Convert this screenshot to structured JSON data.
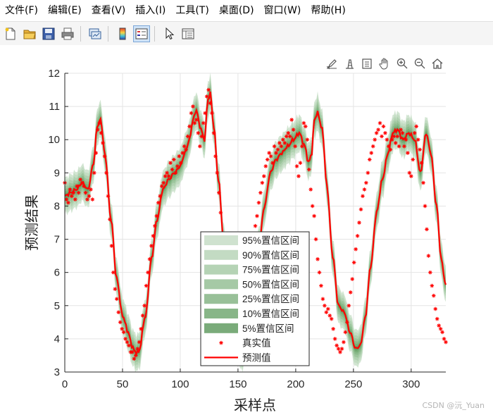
{
  "menu": [
    {
      "label": "文件(F)"
    },
    {
      "label": "编辑(E)"
    },
    {
      "label": "查看(V)"
    },
    {
      "label": "插入(I)"
    },
    {
      "label": "工具(T)"
    },
    {
      "label": "桌面(D)"
    },
    {
      "label": "窗口(W)"
    },
    {
      "label": "帮助(H)"
    }
  ],
  "toolbar_icons": [
    "new-figure-icon",
    "open-folder-icon",
    "save-icon",
    "print-icon",
    "link-plot-icon",
    "colorbar-icon",
    "legend-icon",
    "pointer-icon",
    "property-inspector-icon"
  ],
  "axes_toolbar_icons": [
    "brush-icon",
    "data-tips-icon",
    "rotate-icon",
    "pan-icon",
    "zoom-in-icon",
    "zoom-out-icon",
    "home-icon"
  ],
  "watermark": "CSDN @沅_Yuan",
  "colors": {
    "prediction": "#ff0000",
    "actual": "#ff0000",
    "bands": [
      "#d2e5d2",
      "#c2dcc2",
      "#b0d1b0",
      "#9cc59c",
      "#8aba8a",
      "#78ae78",
      "#669f66"
    ],
    "legend_bands": [
      "#cfe2cf",
      "#c3dbc3",
      "#b5d3b5",
      "#a5c9a5",
      "#98c098",
      "#88b688",
      "#7aab7a"
    ]
  },
  "chart_data": {
    "type": "line",
    "xlabel": "采样点",
    "ylabel": "预测结果",
    "xlim": [
      0,
      330
    ],
    "ylim": [
      3,
      12
    ],
    "xticks": [
      0,
      50,
      100,
      150,
      200,
      250,
      300
    ],
    "yticks": [
      3,
      4,
      5,
      6,
      7,
      8,
      9,
      10,
      11,
      12
    ],
    "grid": true,
    "legend_position": "bottom-center",
    "series": [
      {
        "name": "95%置信区间",
        "kind": "band",
        "halfwidth": 0.55
      },
      {
        "name": "90%置信区间",
        "kind": "band",
        "halfwidth": 0.46
      },
      {
        "name": "75%置信区间",
        "kind": "band",
        "halfwidth": 0.37
      },
      {
        "name": "50%置信区间",
        "kind": "band",
        "halfwidth": 0.28
      },
      {
        "name": "25%置信区间",
        "kind": "band",
        "halfwidth": 0.2
      },
      {
        "name": "10%置信区间",
        "kind": "band",
        "halfwidth": 0.13
      },
      {
        "name": "5%置信区间",
        "kind": "band",
        "halfwidth": 0.07
      },
      {
        "name": "真实值",
        "kind": "markers"
      },
      {
        "name": "预测值",
        "kind": "line"
      }
    ],
    "curve_keypoints": {
      "x": [
        0,
        5,
        10,
        15,
        20,
        25,
        28,
        31,
        35,
        40,
        45,
        50,
        55,
        58,
        61,
        64,
        70,
        75,
        80,
        85,
        90,
        95,
        100,
        104,
        108,
        111,
        114,
        117,
        121,
        124,
        126,
        129,
        133,
        138,
        143,
        148,
        153,
        158,
        163,
        168,
        173,
        178,
        183,
        188,
        193,
        198,
        203,
        208,
        211,
        214,
        216,
        219,
        223,
        227,
        232,
        237,
        242,
        247,
        252,
        256,
        260,
        265,
        270,
        275,
        280,
        284,
        288,
        293,
        298,
        303,
        308,
        313,
        317,
        322,
        326,
        330
      ],
      "y": [
        8.3,
        8.4,
        8.5,
        8.7,
        8.5,
        9.3,
        10.4,
        10.6,
        9.5,
        7.6,
        5.8,
        4.7,
        4.2,
        3.8,
        3.6,
        3.6,
        4.7,
        6.4,
        7.6,
        8.5,
        8.8,
        9.0,
        9.2,
        9.6,
        10.0,
        10.6,
        10.9,
        10.4,
        10.0,
        11.2,
        11.4,
        10.4,
        8.8,
        6.8,
        5.0,
        4.0,
        3.6,
        4.0,
        5.2,
        6.8,
        8.0,
        9.0,
        9.4,
        9.6,
        9.8,
        10.0,
        10.2,
        9.8,
        9.3,
        9.6,
        10.6,
        10.8,
        10.3,
        8.6,
        6.5,
        5.0,
        4.8,
        4.2,
        3.7,
        3.8,
        4.6,
        6.2,
        7.8,
        8.8,
        9.6,
        10.2,
        10.3,
        10.0,
        10.2,
        10.0,
        9.0,
        10.2,
        9.6,
        8.0,
        6.4,
        5.6
      ]
    },
    "actual_points": {
      "x": [
        0,
        1.5,
        3,
        4.5,
        6,
        7.5,
        9,
        10.5,
        12,
        13.5,
        15,
        16.5,
        18,
        19.5,
        21,
        22.5,
        24,
        25.5,
        27,
        28.5,
        30,
        31.5,
        33,
        34.5,
        36,
        37.5,
        39,
        40.5,
        42,
        43.5,
        45,
        46.5,
        48,
        49.5,
        51,
        52.5,
        54,
        55.5,
        57,
        58.5,
        60,
        61.5,
        63,
        64.5,
        66,
        67.5,
        69,
        70.5,
        72,
        73.5,
        75,
        76.5,
        78,
        79.5,
        81,
        82.5,
        84,
        85.5,
        87,
        88.5,
        90,
        91.5,
        93,
        94.5,
        96,
        97.5,
        99,
        100.5,
        102,
        103.5,
        105,
        106.5,
        108,
        109.5,
        111,
        112.5,
        114,
        115.5,
        117,
        118.5,
        120,
        121.5,
        123,
        124.5,
        126,
        127.5,
        129,
        130.5,
        132,
        133.5,
        135,
        136.5,
        138,
        139.5,
        141,
        142.5,
        144,
        145.5,
        147,
        148.5,
        150,
        151.5,
        153,
        154.5,
        156,
        157.5,
        159,
        160.5,
        162,
        163.5,
        165,
        166.5,
        168,
        169.5,
        171,
        172.5,
        174,
        175.5,
        177,
        178.5,
        180,
        181.5,
        183,
        184.5,
        186,
        187.5,
        189,
        190.5,
        192,
        193.5,
        195,
        196.5,
        198,
        199.5,
        201,
        202.5,
        204,
        205.5,
        207,
        208.5,
        210,
        211.5,
        213,
        214.5,
        216,
        217.5,
        219,
        220.5,
        222,
        223.5,
        225,
        226.5,
        228,
        229.5,
        231,
        232.5,
        234,
        235.5,
        237,
        238.5,
        240,
        241.5,
        243,
        244.5,
        246,
        247.5,
        249,
        250.5,
        252,
        253.5,
        255,
        256.5,
        258,
        259.5,
        261,
        262.5,
        264,
        265.5,
        267,
        268.5,
        270,
        271.5,
        273,
        274.5,
        276,
        277.5,
        279,
        280.5,
        282,
        283.5,
        285,
        286.5,
        288,
        289.5,
        291,
        292.5,
        294,
        295.5,
        297,
        298.5,
        300,
        301.5,
        303,
        304.5,
        306,
        307.5,
        309,
        310.5,
        312,
        313.5,
        315,
        316.5,
        318,
        319.5,
        321,
        322.5,
        324,
        325.5,
        327,
        328.5,
        330
      ],
      "y": [
        8.7,
        8.2,
        8.1,
        8.5,
        8.3,
        8.4,
        8.2,
        8.6,
        8.4,
        8.8,
        8.7,
        8.6,
        8.4,
        8.2,
        8.3,
        8.5,
        8.2,
        9.0,
        9.6,
        10.3,
        10.5,
        10.2,
        9.9,
        9.5,
        9.0,
        8.3,
        7.6,
        6.8,
        6.0,
        5.5,
        5.2,
        4.8,
        4.5,
        4.3,
        4.2,
        4.0,
        3.9,
        3.8,
        3.6,
        3.6,
        3.4,
        3.5,
        3.7,
        3.9,
        4.3,
        4.7,
        5.0,
        5.6,
        6.0,
        6.4,
        6.8,
        7.1,
        7.4,
        7.7,
        8.1,
        8.3,
        8.6,
        8.7,
        8.9,
        9.0,
        8.9,
        9.3,
        9.1,
        9.4,
        9.0,
        9.2,
        9.5,
        9.3,
        9.6,
        9.8,
        9.7,
        10.1,
        10.4,
        10.8,
        11.0,
        10.5,
        10.6,
        10.2,
        9.8,
        10.1,
        10.5,
        10.8,
        11.3,
        11.5,
        11.1,
        10.8,
        10.2,
        9.5,
        9.0,
        8.4,
        7.8,
        7.0,
        6.3,
        5.7,
        5.1,
        4.6,
        4.3,
        4.0,
        3.7,
        3.6,
        3.5,
        3.7,
        3.9,
        4.2,
        4.6,
        5.0,
        5.5,
        6.0,
        6.5,
        7.0,
        7.4,
        7.7,
        8.1,
        8.4,
        8.7,
        8.9,
        9.2,
        9.4,
        9.6,
        9.5,
        9.3,
        9.8,
        9.6,
        9.7,
        9.9,
        9.8,
        10.0,
        9.9,
        10.1,
        10.2,
        10.1,
        10.6,
        10.3,
        9.8,
        9.2,
        8.9,
        9.3,
        9.8,
        10.5,
        10.4,
        10.0,
        9.1,
        8.5,
        8.0,
        7.7,
        7.0,
        6.4,
        6.0,
        5.6,
        5.2,
        5.0,
        4.8,
        4.9,
        4.7,
        4.6,
        4.3,
        4.0,
        3.8,
        3.7,
        3.6,
        3.7,
        3.9,
        4.2,
        4.5,
        5.0,
        5.4,
        5.8,
        6.3,
        6.7,
        7.1,
        7.5,
        7.9,
        8.3,
        8.5,
        8.7,
        9.0,
        9.4,
        9.6,
        9.8,
        10.0,
        10.2,
        10.3,
        10.5,
        10.1,
        10.4,
        10.2,
        10.0,
        9.8,
        9.7,
        10.0,
        10.1,
        9.9,
        10.1,
        9.8,
        10.3,
        10.2,
        9.8,
        10.0,
        9.6,
        9.0,
        8.9,
        9.4,
        10.2,
        10.4,
        10.0,
        9.7,
        9.3,
        8.7,
        8.0,
        7.3,
        6.5,
        6.0,
        5.6,
        5.3,
        4.9,
        4.6,
        4.4,
        4.3,
        4.2,
        4.0,
        3.9,
        3.7,
        3.6,
        3.5
      ]
    }
  }
}
